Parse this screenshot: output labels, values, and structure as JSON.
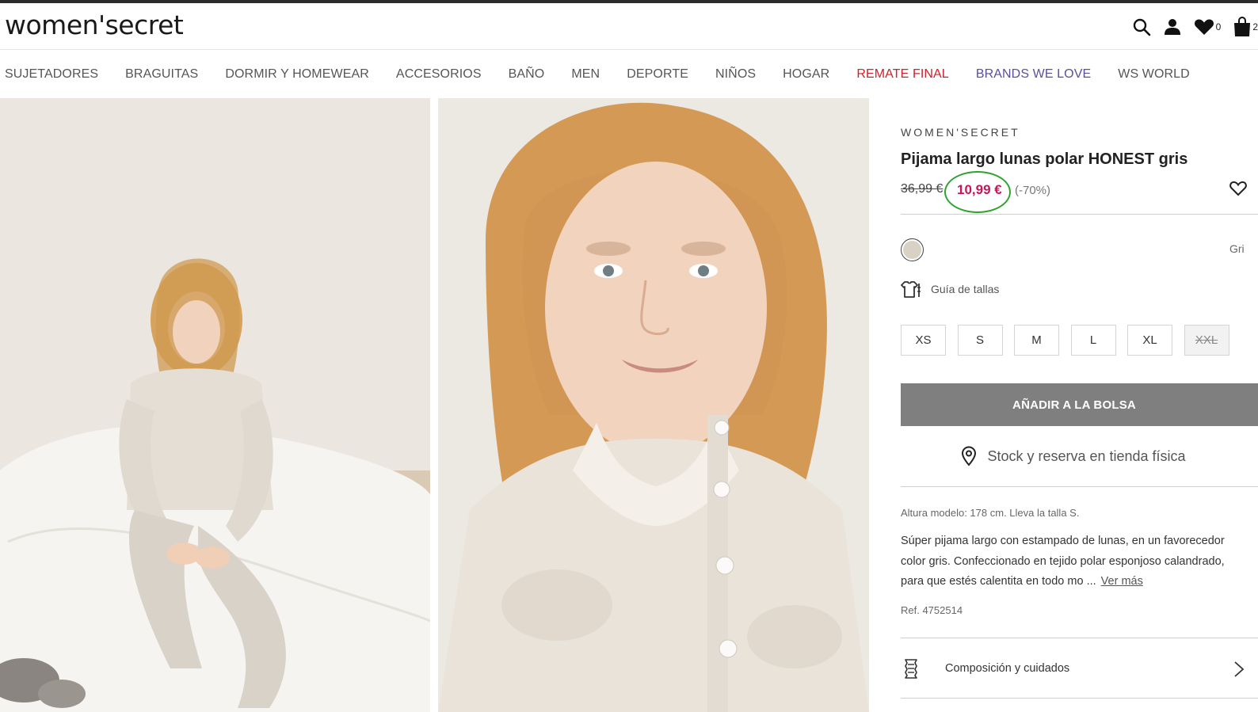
{
  "header": {
    "logo": "women'secret",
    "wishlist_count": "0",
    "bag_count": "2"
  },
  "nav": {
    "items": [
      {
        "label": "SUJETADORES"
      },
      {
        "label": "BRAGUITAS"
      },
      {
        "label": "DORMIR Y HOMEWEAR"
      },
      {
        "label": "ACCESORIOS"
      },
      {
        "label": "BAÑO"
      },
      {
        "label": "MEN"
      },
      {
        "label": "DEPORTE"
      },
      {
        "label": "NIÑOS"
      },
      {
        "label": "HOGAR"
      },
      {
        "label": "REMATE FINAL",
        "color": "#d0202a"
      },
      {
        "label": "BRANDS WE LOVE",
        "color": "#5a4f9c"
      },
      {
        "label": "WS WORLD"
      }
    ]
  },
  "product": {
    "brand": "WOMEN'SECRET",
    "title": "Pijama largo lunas polar HONEST gris",
    "old_price": "36,99 €",
    "price": "10,99 €",
    "discount": "(-70%)",
    "price_color": "#c2185b",
    "highlight_color": "#2ea32e",
    "color_name": "Gri",
    "size_guide_label": "Guía de tallas",
    "sizes": [
      {
        "label": "XS",
        "available": true
      },
      {
        "label": "S",
        "available": true
      },
      {
        "label": "M",
        "available": true
      },
      {
        "label": "L",
        "available": true
      },
      {
        "label": "XL",
        "available": true
      },
      {
        "label": "XXL",
        "available": false
      }
    ],
    "add_button": "AÑADIR A LA BOLSA",
    "stock_label": "Stock y reserva en tienda física",
    "model_info": "Altura modelo: 178 cm.  Lleva la talla S.",
    "description": "Súper pijama largo con estampado de lunas, en un favorecedor color gris. Confeccionado en tejido polar esponjoso calandrado, para que estés calentita en todo mo ...",
    "see_more": "Ver más",
    "ref": "Ref. 4752514",
    "composition_label": "Composición y cuidados"
  }
}
